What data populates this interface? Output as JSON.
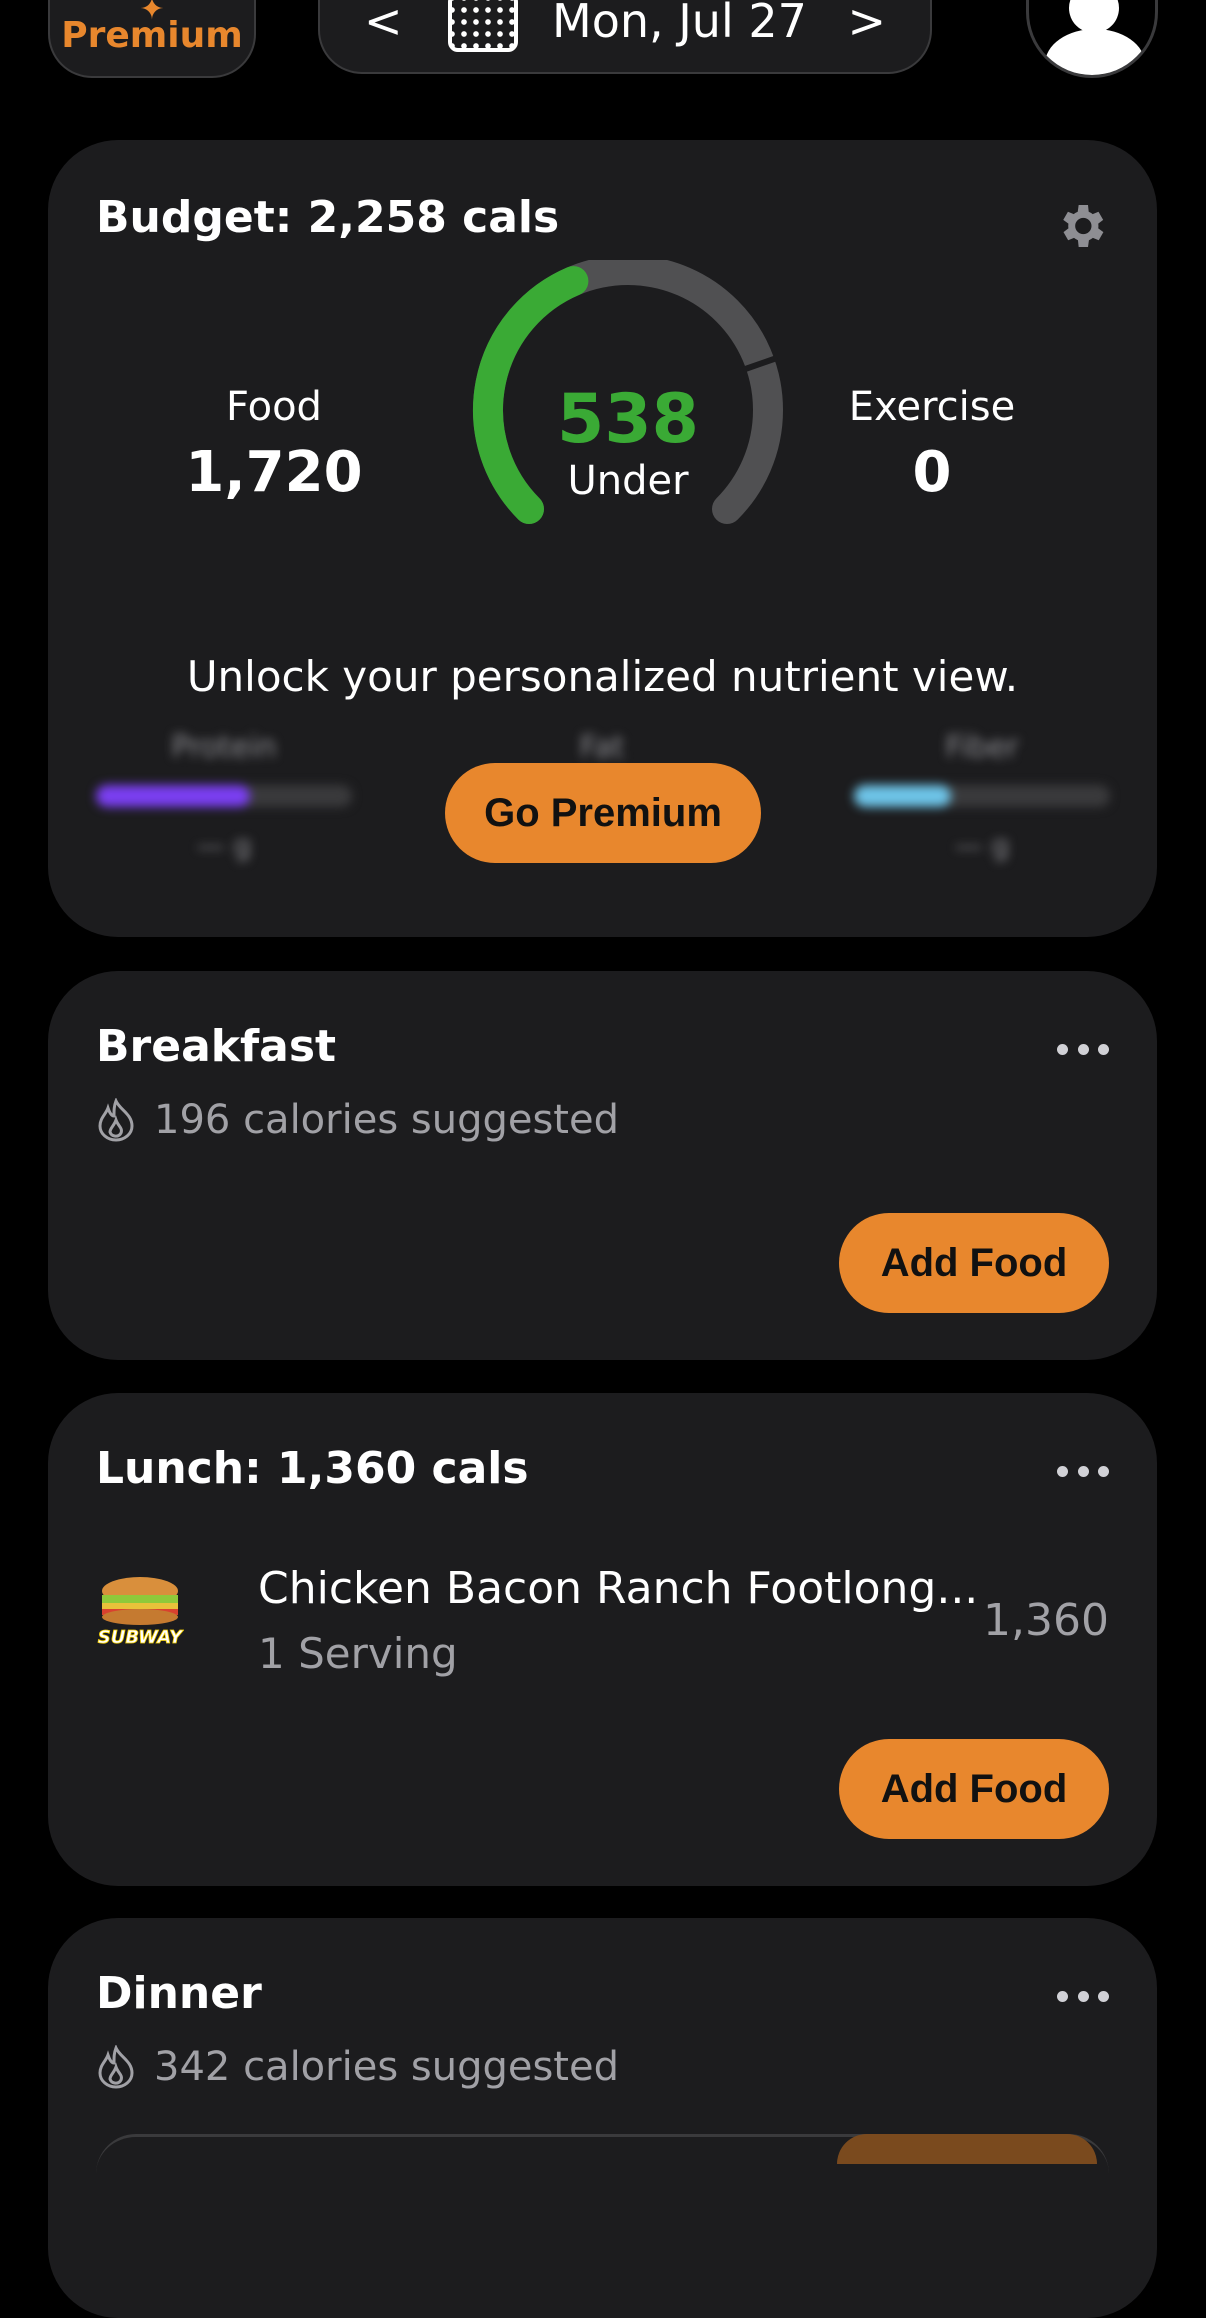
{
  "topbar": {
    "premium_label": "Premium",
    "date_label": "Mon, Jul 27",
    "prev_glyph": "<",
    "next_glyph": ">"
  },
  "budget": {
    "title": "Budget: 2,258 cals",
    "food_label": "Food",
    "food_value": "1,720",
    "exercise_label": "Exercise",
    "exercise_value": "0",
    "gauge_value": "538",
    "gauge_label": "Under",
    "gauge_fraction_used": 0.762,
    "unlock_text": "Unlock your personalized nutrient view.",
    "go_premium_label": "Go Premium",
    "blurred_nutrients": [
      {
        "label": "Protein",
        "color": "#7b3ff2",
        "fill": 0.6
      },
      {
        "label": "Fat",
        "color": "#888888",
        "fill": 0.0
      },
      {
        "label": "Fiber",
        "color": "#6ec4e8",
        "fill": 0.38
      }
    ]
  },
  "breakfast": {
    "title": "Breakfast",
    "suggested": "196 calories suggested",
    "add_label": "Add Food"
  },
  "lunch": {
    "title": "Lunch: 1,360 cals",
    "items": [
      {
        "name": "Chicken Bacon Ranch Footlong...",
        "serving": "1 Serving",
        "calories": "1,360",
        "brand": "SUBWAY"
      }
    ],
    "add_label": "Add Food"
  },
  "dinner": {
    "title": "Dinner",
    "suggested": "342 calories suggested"
  },
  "colors": {
    "accent": "#e8872d",
    "gauge_green": "#3aaa35",
    "card_bg": "#1c1c1e",
    "muted_text": "#a1a1a6"
  }
}
